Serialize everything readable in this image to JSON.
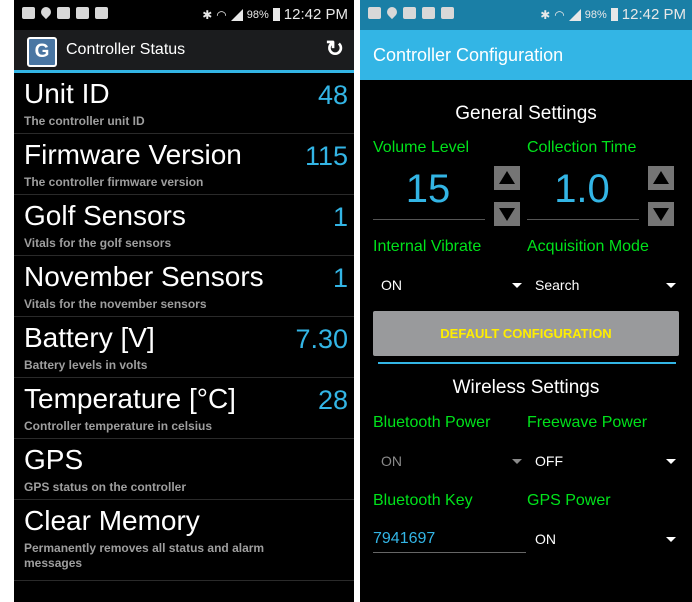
{
  "status_bar": {
    "battery_pct": "98%",
    "time": "12:42 PM",
    "network": "4G"
  },
  "left": {
    "app_title": "Controller Status",
    "logo_letter": "G",
    "items": [
      {
        "label": "Unit ID",
        "value": "48",
        "desc": "The controller unit ID"
      },
      {
        "label": "Firmware Version",
        "value": "115",
        "desc": "The controller firmware version"
      },
      {
        "label": "Golf Sensors",
        "value": "1",
        "desc": "Vitals for the golf sensors"
      },
      {
        "label": "November Sensors",
        "value": "1",
        "desc": "Vitals for the november sensors"
      },
      {
        "label": "Battery [V]",
        "value": "7.30",
        "desc": "Battery levels in volts"
      },
      {
        "label": "Temperature [°C]",
        "value": "28",
        "desc": "Controller temperature in celsius"
      },
      {
        "label": "GPS",
        "value": "",
        "desc": "GPS status on the controller"
      },
      {
        "label": "Clear Memory",
        "value": "",
        "desc": "Permanently removes all status and alarm messages"
      }
    ]
  },
  "right": {
    "app_title": "Controller Configuration",
    "general_title": "General Settings",
    "volume_label": "Volume Level",
    "volume_value": "15",
    "collection_label": "Collection Time",
    "collection_value": "1.0",
    "vibrate_label": "Internal Vibrate",
    "vibrate_value": "ON",
    "acq_label": "Acquisition Mode",
    "acq_value": "Search",
    "default_button": "DEFAULT CONFIGURATION",
    "wireless_title": "Wireless Settings",
    "bt_power_label": "Bluetooth Power",
    "bt_power_value": "ON",
    "fw_power_label": "Freewave Power",
    "fw_power_value": "OFF",
    "bt_key_label": "Bluetooth Key",
    "bt_key_value": "7941697",
    "gps_power_label": "GPS Power",
    "gps_power_value": "ON"
  }
}
